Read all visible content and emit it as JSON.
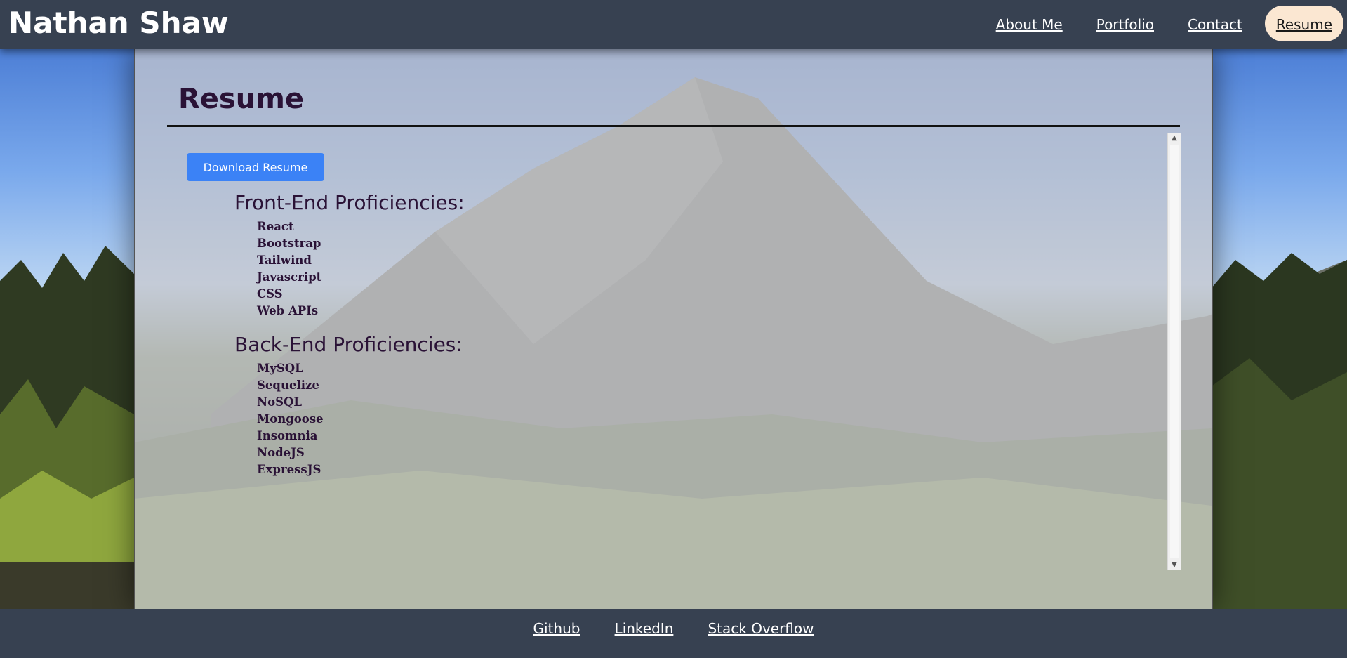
{
  "header": {
    "brand": "Nathan Shaw",
    "nav": [
      {
        "label": "About Me"
      },
      {
        "label": "Portfolio"
      },
      {
        "label": "Contact"
      },
      {
        "label": "Resume",
        "active": true
      }
    ]
  },
  "main": {
    "title": "Resume",
    "download_label": "Download Resume",
    "front_end": {
      "heading": "Front-End Proficiencies:",
      "items": [
        "React",
        "Bootstrap",
        "Tailwind",
        "Javascript",
        "CSS",
        "Web APIs"
      ]
    },
    "back_end": {
      "heading": "Back-End Proficiencies:",
      "items": [
        "MySQL",
        "Sequelize",
        "NoSQL",
        "Mongoose",
        "Insomnia",
        "NodeJS",
        "ExpressJS"
      ]
    }
  },
  "footer": {
    "links": [
      {
        "label": "Github"
      },
      {
        "label": "LinkedIn"
      },
      {
        "label": "Stack Overflow"
      }
    ]
  },
  "colors": {
    "header_bg": "#374151",
    "active_nav_bg": "#fbe7d2",
    "button_bg": "#3b82f6",
    "heading_text": "#2a1236"
  }
}
